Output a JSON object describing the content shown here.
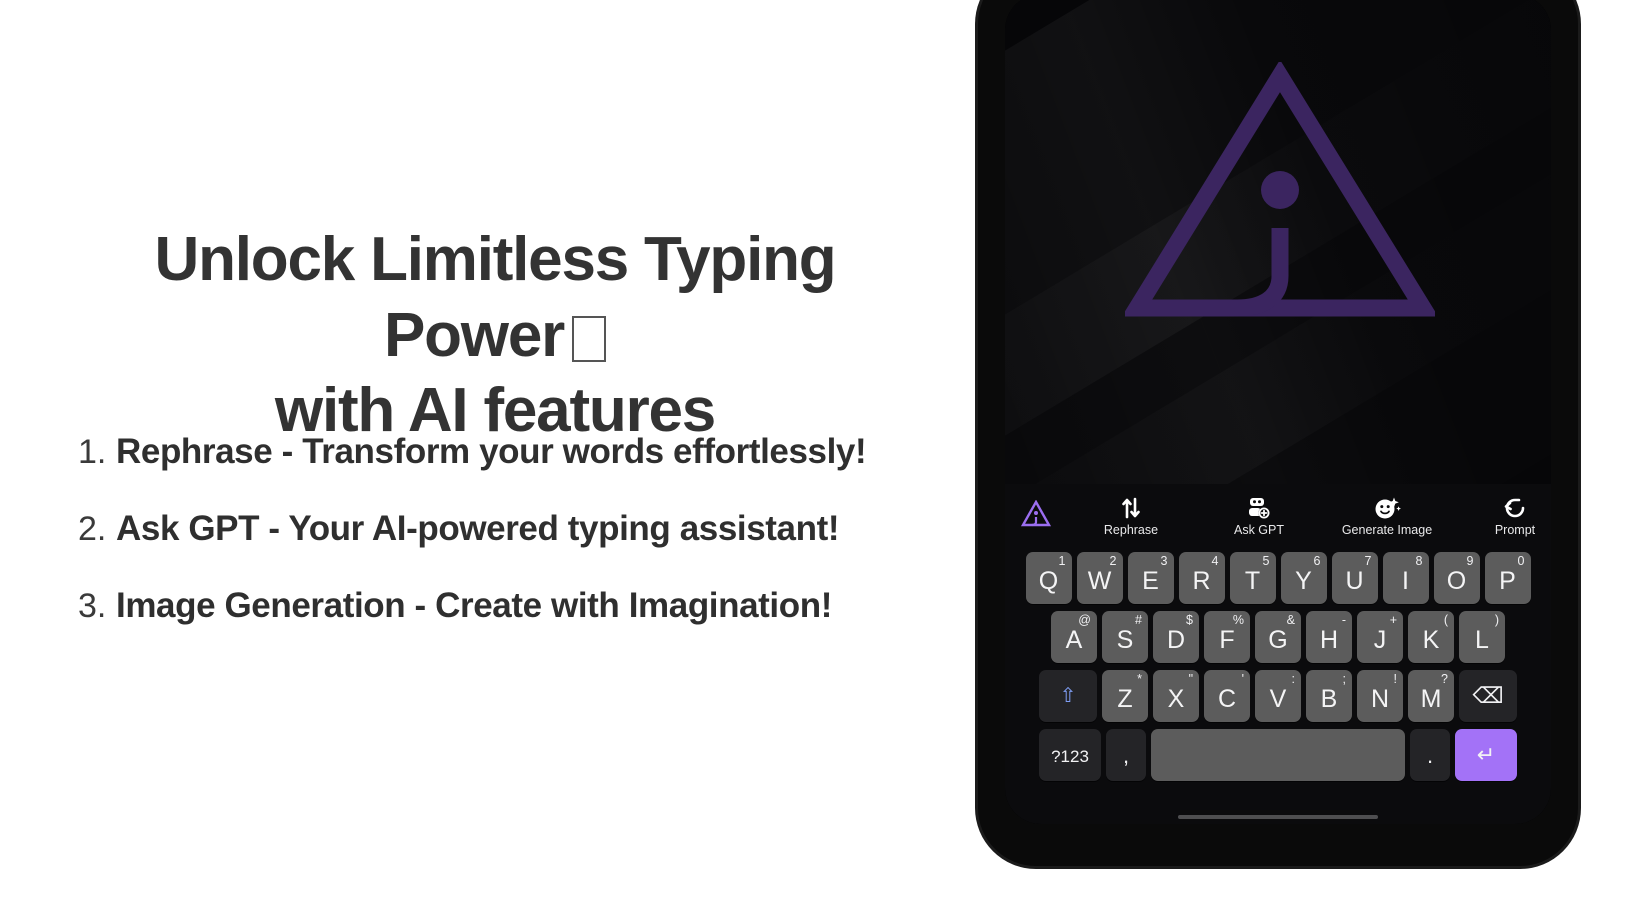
{
  "headline": {
    "line1": "Unlock Limitless Typing Power",
    "line2": "with AI features",
    "emoji_missing_glyph": "\u0000"
  },
  "features": [
    {
      "number": "1.",
      "text": "Rephrase - Transform your words effortlessly!"
    },
    {
      "number": "2.",
      "text": "Ask GPT - Your AI-powered typing assistant!"
    },
    {
      "number": "3.",
      "text": "Image Generation - Create with Imagination!"
    }
  ],
  "phone": {
    "wallpaper": {
      "logo_name": "ai-triangle-logo",
      "logo_color": "#3b2560"
    },
    "ai_toolbar": {
      "app_logo_color": "#9b6ef0",
      "items": [
        {
          "icon": "app-logo-icon",
          "label": ""
        },
        {
          "icon": "rephrase-arrows-icon",
          "label": "Rephrase"
        },
        {
          "icon": "robot-plus-icon",
          "label": "Ask GPT"
        },
        {
          "icon": "sparkle-face-icon",
          "label": "Generate Image"
        },
        {
          "icon": "prompt-icon",
          "label": "Prompt"
        }
      ]
    },
    "keyboard": {
      "accent_color": "#a372f7",
      "row1": [
        {
          "key": "Q",
          "sup": "1"
        },
        {
          "key": "W",
          "sup": "2"
        },
        {
          "key": "E",
          "sup": "3"
        },
        {
          "key": "R",
          "sup": "4"
        },
        {
          "key": "T",
          "sup": "5"
        },
        {
          "key": "Y",
          "sup": "6"
        },
        {
          "key": "U",
          "sup": "7"
        },
        {
          "key": "I",
          "sup": "8"
        },
        {
          "key": "O",
          "sup": "9"
        },
        {
          "key": "P",
          "sup": "0"
        }
      ],
      "row2": [
        {
          "key": "A",
          "sup": "@"
        },
        {
          "key": "S",
          "sup": "#"
        },
        {
          "key": "D",
          "sup": "$"
        },
        {
          "key": "F",
          "sup": "%"
        },
        {
          "key": "G",
          "sup": "&"
        },
        {
          "key": "H",
          "sup": "-"
        },
        {
          "key": "J",
          "sup": "+"
        },
        {
          "key": "K",
          "sup": "("
        },
        {
          "key": "L",
          "sup": ")"
        }
      ],
      "row3": [
        {
          "key": "Z",
          "sup": "*"
        },
        {
          "key": "X",
          "sup": "\""
        },
        {
          "key": "C",
          "sup": "'"
        },
        {
          "key": "V",
          "sup": ":"
        },
        {
          "key": "B",
          "sup": ";"
        },
        {
          "key": "N",
          "sup": "!"
        },
        {
          "key": "M",
          "sup": "?"
        }
      ],
      "shift_label": "⇧",
      "backspace_label": "⌫",
      "symbols_label": "?123",
      "comma_label": ",",
      "space_label": "",
      "period_label": ".",
      "enter_label": "↵"
    }
  }
}
